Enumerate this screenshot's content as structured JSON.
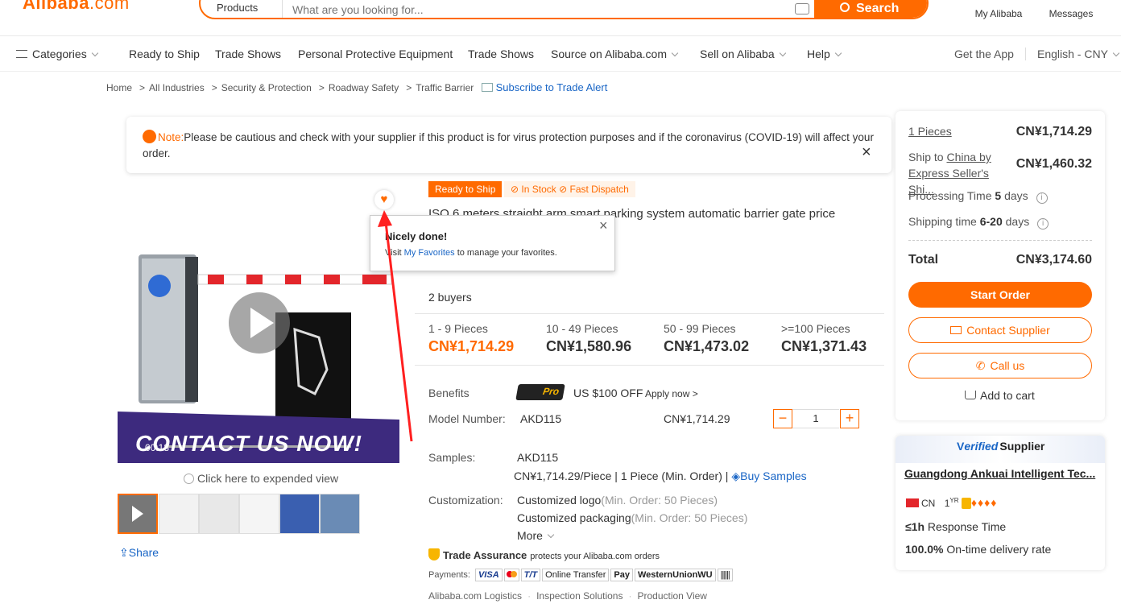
{
  "header": {
    "logo": "Alibaba",
    "logo_domain": ".com",
    "search_category": "Products",
    "search_placeholder": "What are you looking for...",
    "search_button": "Search",
    "my_alibaba": "My Alibaba",
    "messages": "Messages"
  },
  "nav": {
    "categories": "Categories",
    "items": [
      "Ready to Ship",
      "Trade Shows",
      "Personal Protective Equipment",
      "Trade Shows",
      "Source on Alibaba.com",
      "Sell on Alibaba",
      "Help"
    ],
    "get_app": "Get the App",
    "language": "English - CNY"
  },
  "breadcrumb": {
    "items": [
      "Home",
      "All Industries",
      "Security & Protection",
      "Roadway Safety",
      "Traffic Barrier"
    ],
    "subscribe": "Subscribe to Trade Alert"
  },
  "note": {
    "prefix": "Note:",
    "text": "Please be cautious and check with your supplier if this product is for virus protection purposes and if the coronavirus (COVID-19) will affect your order."
  },
  "gallery": {
    "expand_label": "Click here to expended view",
    "share": "Share",
    "video_text": "CONTACT US NOW!",
    "video_time": "00:18"
  },
  "product": {
    "badge_ready": "Ready to Ship",
    "badge_stock": "In Stock",
    "badge_dispatch": "Fast Dispatch",
    "title": "ISO 6 meters straight arm smart parking system automatic barrier gate price",
    "buyers": "2 buyers",
    "tiers": [
      {
        "qty": "1 - 9 Pieces",
        "price": "CN¥1,714.29"
      },
      {
        "qty": "10 - 49 Pieces",
        "price": "CN¥1,580.96"
      },
      {
        "qty": "50 - 99 Pieces",
        "price": "CN¥1,473.02"
      },
      {
        "qty": ">=100 Pieces",
        "price": "CN¥1,371.43"
      }
    ],
    "benefits_label": "Benefits",
    "pro_badge": "Pro",
    "benefit_offer": "US $100 OFF",
    "apply_now": "Apply now >",
    "model_label": "Model Number:",
    "model_value": "AKD115",
    "model_price": "CN¥1,714.29",
    "quantity": "1",
    "samples_label": "Samples:",
    "samples_value": "AKD115",
    "samples_price": "CN¥1,714.29/Piece | 1 Piece (Min. Order) |",
    "buy_samples": "Buy Samples",
    "custom_label": "Customization:",
    "custom_logo": "Customized logo",
    "custom_logo_min": "(Min. Order: 50 Pieces)",
    "custom_pack": "Customized packaging",
    "custom_pack_min": "(Min. Order: 50 Pieces)",
    "more": "More",
    "trade_assurance": "Trade Assurance",
    "trade_assurance_desc": "protects your Alibaba.com orders",
    "payments_label": "Payments:",
    "payments": [
      "VISA",
      "T/T",
      "Online Transfer",
      "Pay",
      "WesternUnion",
      "WU"
    ],
    "logistics": [
      "Alibaba.com Logistics",
      "Inspection Solutions",
      "Production View"
    ]
  },
  "popup": {
    "title": "Nicely done!",
    "text_pre": "Visit",
    "link": "My Favorites",
    "text_post": "to manage your favorites."
  },
  "order_card": {
    "pieces_link": "1 Pieces",
    "pieces_price": "CN¥1,714.29",
    "ship_to": "Ship to",
    "ship_dest": "China by",
    "ship_method": "Express Seller's Shi...",
    "ship_price": "CN¥1,460.32",
    "processing_label": "Processing Time",
    "processing_value": "5",
    "processing_unit": "days",
    "shipping_label": "Shipping time",
    "shipping_value": "6-20",
    "shipping_unit": "days",
    "total_label": "Total",
    "total_value": "CN¥3,174.60",
    "start_order": "Start Order",
    "contact_supplier": "Contact Supplier",
    "call_us": "Call us",
    "add_to_cart": "Add to cart"
  },
  "supplier_card": {
    "verified_v": "V",
    "verified": "erified",
    "supplier": "Supplier",
    "name": "Guangdong Ankuai Intelligent Tec...",
    "country": "CN",
    "years": "1",
    "years_unit": "YR",
    "response_value": "≤1h",
    "response_label": "Response Time",
    "delivery_value": "100.0%",
    "delivery_label": "On-time delivery rate"
  },
  "colors": {
    "accent": "#ff6a00",
    "link": "#1a66c6",
    "annotation_arrow": "#ff2020"
  }
}
